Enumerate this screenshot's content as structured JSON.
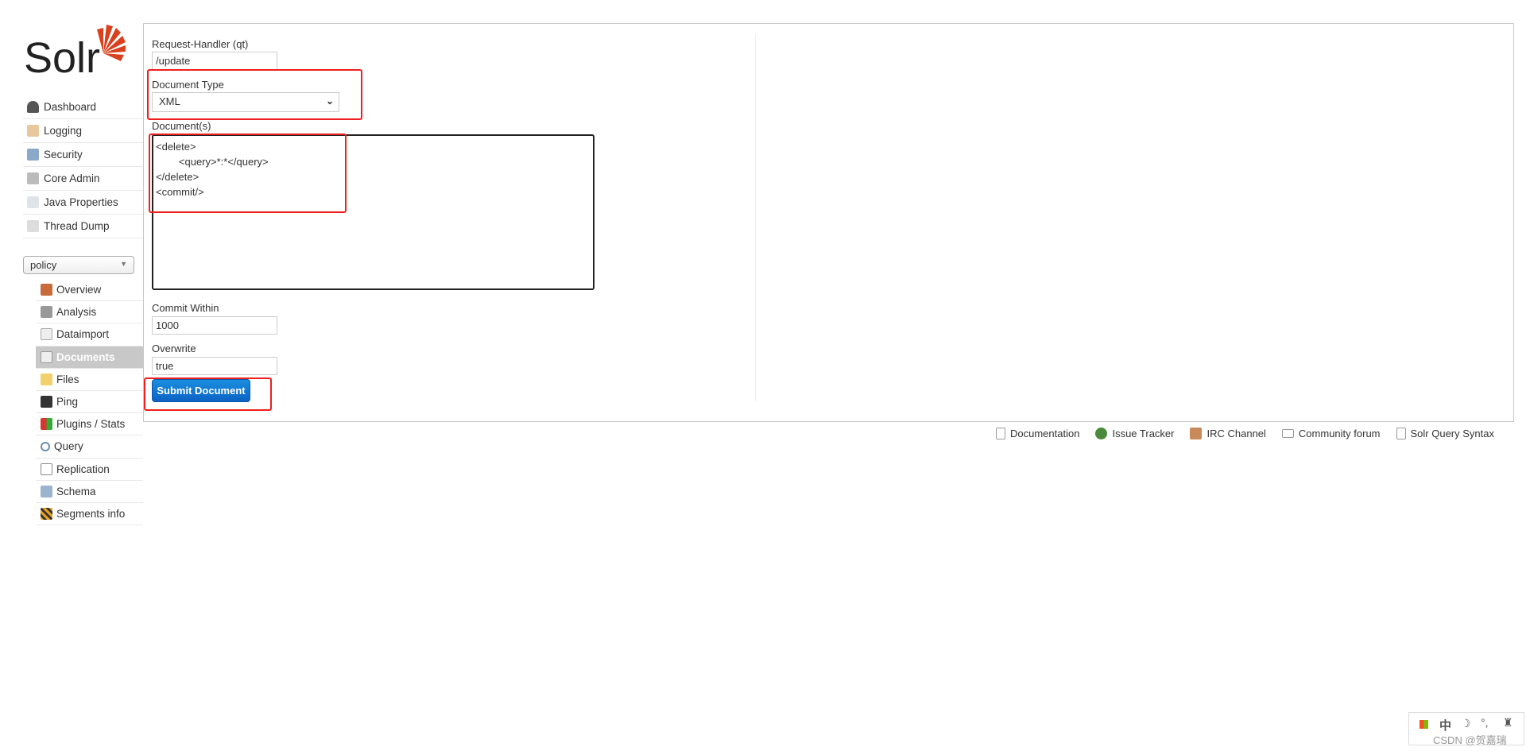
{
  "logo_text": "Solr",
  "colors": {
    "accent": "#d9411e",
    "button": "#0b62c4",
    "highlight": "#f01e1e"
  },
  "sidebar": {
    "items": [
      {
        "label": "Dashboard",
        "icon": "dashboard-icon"
      },
      {
        "label": "Logging",
        "icon": "logging-icon"
      },
      {
        "label": "Security",
        "icon": "security-icon"
      },
      {
        "label": "Core Admin",
        "icon": "core-admin-icon"
      },
      {
        "label": "Java Properties",
        "icon": "java-icon"
      },
      {
        "label": "Thread Dump",
        "icon": "thread-dump-icon"
      }
    ]
  },
  "core_selector": {
    "value": "policy"
  },
  "core_menu": {
    "items": [
      {
        "label": "Overview"
      },
      {
        "label": "Analysis"
      },
      {
        "label": "Dataimport"
      },
      {
        "label": "Documents"
      },
      {
        "label": "Files"
      },
      {
        "label": "Ping"
      },
      {
        "label": "Plugins / Stats"
      },
      {
        "label": "Query"
      },
      {
        "label": "Replication"
      },
      {
        "label": "Schema"
      },
      {
        "label": "Segments info"
      }
    ]
  },
  "form": {
    "request_handler_label": "Request-Handler (qt)",
    "request_handler_value": "/update",
    "doc_type_label": "Document Type",
    "doc_type_value": "XML",
    "documents_label": "Document(s)",
    "documents_value": "<delete>\n        <query>*:*</query>\n</delete>\n<commit/>",
    "commit_within_label": "Commit Within",
    "commit_within_value": "1000",
    "overwrite_label": "Overwrite",
    "overwrite_value": "true",
    "submit_label": "Submit Document"
  },
  "footer": {
    "links": [
      {
        "label": "Documentation"
      },
      {
        "label": "Issue Tracker"
      },
      {
        "label": "IRC Channel"
      },
      {
        "label": "Community forum"
      },
      {
        "label": "Solr Query Syntax"
      }
    ]
  },
  "ime": {
    "lang": "中",
    "watermark": "CSDN @贺嘉瑞"
  }
}
